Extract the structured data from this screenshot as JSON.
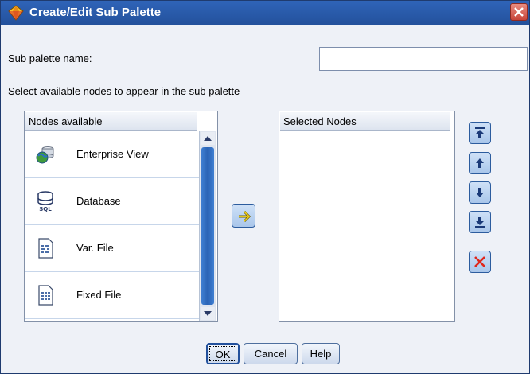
{
  "window": {
    "title": "Create/Edit Sub Palette",
    "icon": "palette-diamond-icon",
    "close_icon": "close-icon"
  },
  "form": {
    "sub_palette_name_label": "Sub palette name:",
    "sub_palette_name_value": "",
    "instruction": "Select available nodes to appear in the sub palette"
  },
  "nodes_available": {
    "header": "Nodes available",
    "items": [
      {
        "label": "Enterprise View",
        "icon": "enterprise-view-icon"
      },
      {
        "label": "Database",
        "icon": "database-sql-icon"
      },
      {
        "label": "Var. File",
        "icon": "var-file-icon"
      },
      {
        "label": "Fixed File",
        "icon": "fixed-file-icon"
      }
    ]
  },
  "selected_nodes": {
    "header": "Selected Nodes",
    "items": []
  },
  "buttons": {
    "ok": "OK",
    "cancel": "Cancel",
    "help": "Help"
  },
  "colors": {
    "titlebar": "#2a5aa8",
    "list_border": "#8391a8",
    "button_face": "#a9c6ea",
    "delete_red": "#e0261b",
    "add_arrow": "#f2d21a"
  }
}
